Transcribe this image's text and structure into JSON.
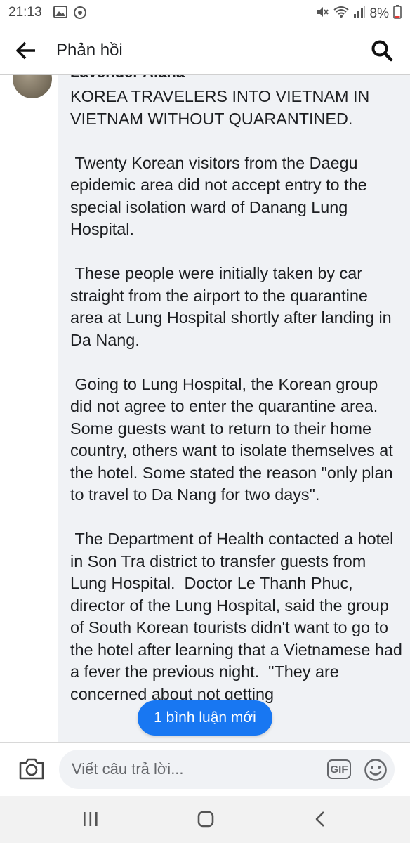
{
  "status_bar": {
    "time": "21:13",
    "battery": "8%",
    "icons": [
      "gallery-icon",
      "sync-icon",
      "mute-icon",
      "wifi-icon",
      "signal-icon",
      "battery-icon"
    ]
  },
  "header": {
    "title": "Phản hồi",
    "back_icon": "back-arrow-icon",
    "search_icon": "search-icon"
  },
  "comment": {
    "author": "Lavender Alana",
    "text": "KOREA TRAVELERS INTO VIETNAM IN VIETNAM WITHOUT QUARANTINED.\n\n Twenty Korean visitors from the Daegu epidemic area did not accept entry to the special isolation ward of Danang Lung Hospital.\n\n These people were initially taken by car straight from the airport to the quarantine area at Lung Hospital shortly after landing in Da Nang.\n\n Going to Lung Hospital, the Korean group did not agree to enter the quarantine area.  Some guests want to return to their home country, others want to isolate themselves at the hotel. Some stated the reason \"only plan to travel to Da Nang for two days\".\n\n The Department of Health contacted a hotel in Son Tra district to transfer guests from Lung Hospital.  Doctor Le Thanh Phuc, director of the Lung Hospital, said the group of South Korean tourists didn't want to go to the hotel after learning that a Vietnamese had a fever the previous night.  \"They are concerned about not getting"
  },
  "new_comments_button": "1 bình luận mới",
  "composer": {
    "placeholder": "Viết câu trả lời...",
    "gif_label": "GIF"
  },
  "nav_bar": {
    "icons": [
      "recent-apps-icon",
      "home-icon",
      "back-icon"
    ]
  },
  "colors": {
    "accent": "#1877f2",
    "bubble": "#f0f2f5",
    "text": "#1c1e21",
    "secondary": "#65676b"
  }
}
